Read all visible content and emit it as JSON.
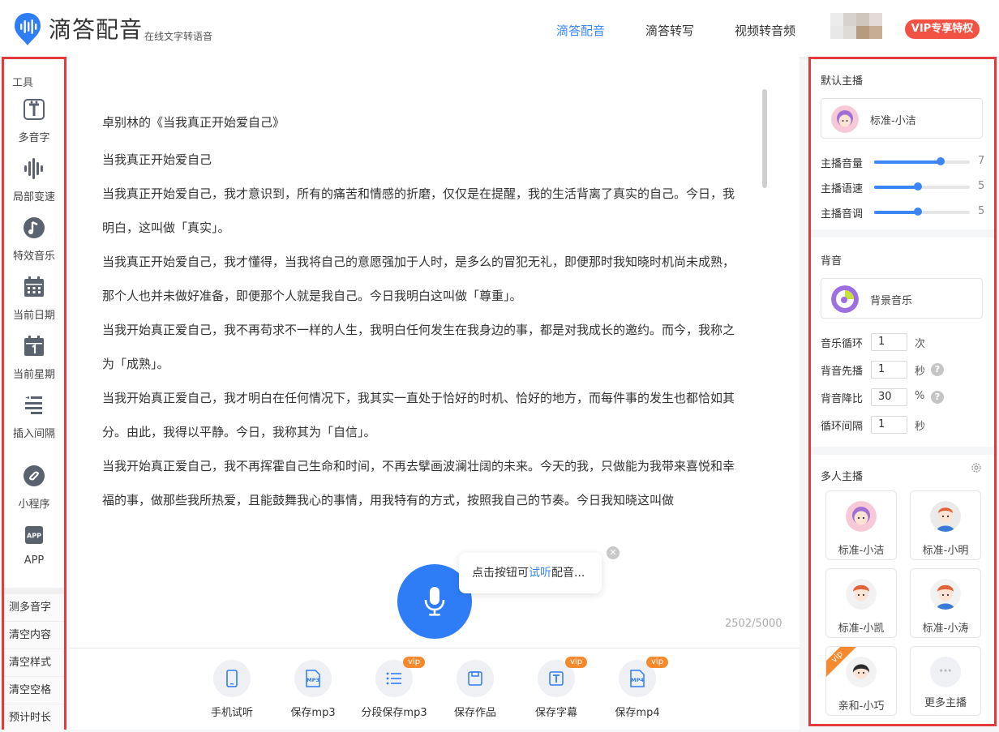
{
  "header": {
    "logo_text": "滴答配音",
    "logo_sub": "在线文字转语音",
    "nav": [
      {
        "label": "滴答配音",
        "active": true
      },
      {
        "label": "滴答转写",
        "active": false
      },
      {
        "label": "视频转音频",
        "active": false
      }
    ],
    "vip_label": "VIP专享特权",
    "colors": {
      "accent": "#3a86f7",
      "vip": "#f25243"
    }
  },
  "leftbar": {
    "section_label": "工具",
    "tools": [
      {
        "label": "多音字",
        "icon": "polyphone-icon"
      },
      {
        "label": "局部变速",
        "icon": "waveform-icon"
      },
      {
        "label": "特效音乐",
        "icon": "music-note-icon"
      },
      {
        "label": "当前日期",
        "icon": "calendar-icon"
      },
      {
        "label": "当前星期",
        "icon": "calendar-week-icon"
      },
      {
        "label": "插入间隔",
        "icon": "insert-pause-icon"
      },
      {
        "label": "小程序",
        "icon": "miniprogram-icon"
      },
      {
        "label": "APP",
        "icon": "app-icon"
      }
    ],
    "buttons": [
      "测多音字",
      "清空内容",
      "清空样式",
      "清空空格",
      "预计时长"
    ]
  },
  "editor": {
    "title": "卓别林的《当我真正开始爱自己》",
    "paragraphs": [
      "当我真正开始爱自己",
      "当我真正开始爱自己，我才意识到，所有的痛苦和情感的折磨，仅仅是在提醒，我的生活背离了真实的自己。今日，我明白，这叫做「真实」。",
      "当我真正开始爱自己，我才懂得，当我将自己的意愿强加于人时，是多么的冒犯无礼，即便那时我知晓时机尚未成熟，那个人也并未做好准备，即便那个人就是我自己。今日我明白这叫做「尊重」。",
      "当我开始真正爱自己，我不再苟求不一样的人生，我明白任何发生在我身边的事，都是对我成长的邀约。而今，我称之为「成熟」。",
      "当我开始真正爱自己，我才明白在任何情况下，我其实一直处于恰好的时机、恰好的地方，而每件事的发生也都恰如其分。由此，我得以平静。今日，我称其为「自信」。",
      "当我开始真正爱自己，我不再挥霍自己生命和时间，不再去擘画波澜壮阔的未来。今天的我，只做能为我带来喜悦和幸福的事，做那些我所热爱，且能鼓舞我心的事情，用我特有的方式，按照我自己的节奏。今日我知晓这叫做"
    ],
    "tooltip_before": "点击按钮可",
    "tooltip_link": "试听",
    "tooltip_after": "配音...",
    "counter": "2502/5000",
    "actions": [
      {
        "label": "手机试听",
        "icon": "phone-icon",
        "vip": false
      },
      {
        "label": "保存mp3",
        "icon": "mp3-file-icon",
        "vip": false
      },
      {
        "label": "分段保存mp3",
        "icon": "list-icon",
        "vip": true
      },
      {
        "label": "保存作品",
        "icon": "save-icon",
        "vip": false
      },
      {
        "label": "保存字幕",
        "icon": "subtitle-icon",
        "vip": true
      },
      {
        "label": "保存mp4",
        "icon": "mp4-file-icon",
        "vip": true
      }
    ],
    "vip_tag": "vip"
  },
  "rightpanel": {
    "default_anchor_title": "默认主播",
    "default_anchor_name": "标准-小洁",
    "sliders": [
      {
        "label": "主播音量",
        "value": "7",
        "fraction": 0.7
      },
      {
        "label": "主播语速",
        "value": "5",
        "fraction": 0.45
      },
      {
        "label": "主播音调",
        "value": "5",
        "fraction": 0.45
      }
    ],
    "bg_title": "背音",
    "bg_music_name": "背景音乐",
    "bg_rows": [
      {
        "label": "音乐循环",
        "value": "1",
        "unit": "次",
        "help": false
      },
      {
        "label": "背音先播",
        "value": "1",
        "unit": "秒",
        "help": true
      },
      {
        "label": "背音降比",
        "value": "30",
        "unit": "%",
        "help": true
      },
      {
        "label": "循环间隔",
        "value": "1",
        "unit": "秒",
        "help": false
      }
    ],
    "help_glyph": "?",
    "multi_title": "多人主播",
    "multi_anchors": [
      {
        "name": "标准-小洁",
        "vip": false
      },
      {
        "name": "标准-小明",
        "vip": false
      },
      {
        "name": "标准-小凯",
        "vip": false
      },
      {
        "name": "标准-小涛",
        "vip": false
      },
      {
        "name": "亲和-小巧",
        "vip": true
      },
      {
        "name": "更多主播",
        "vip": false
      }
    ],
    "vip_corner": "vip",
    "more_glyph": "···"
  }
}
